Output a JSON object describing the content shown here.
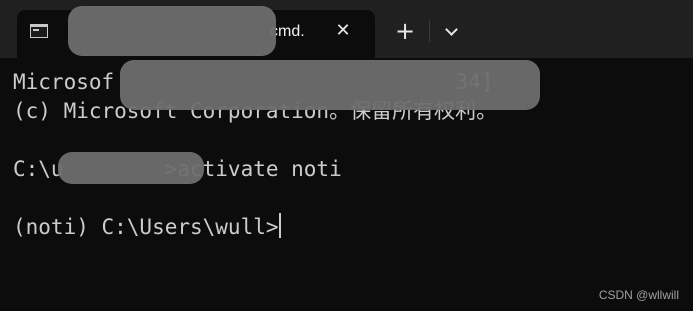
{
  "tab": {
    "icon": "terminal-icon",
    "title": "cmd.",
    "close_icon": "close-icon"
  },
  "toolbar": {
    "new_tab_icon": "plus-icon",
    "dropdown_icon": "chevron-down-icon"
  },
  "terminal": {
    "lines": [
      "Microsof                           34]",
      "(c) Microsoft Corporation。保留所有权利。",
      "",
      "C:\\u        >activate noti",
      "",
      "(noti) C:\\Users\\wull>"
    ]
  },
  "watermark": "CSDN @wllwill",
  "colors": {
    "background": "#0c0c0c",
    "titlebar": "#202020",
    "text": "#cccccc"
  }
}
